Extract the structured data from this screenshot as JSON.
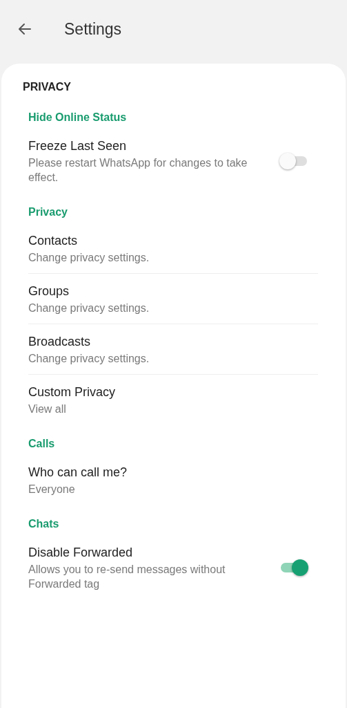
{
  "header": {
    "title": "Settings"
  },
  "section_title": "PRIVACY",
  "groups": [
    {
      "title": "Hide Online Status",
      "items": [
        {
          "kind": "toggle",
          "title": "Freeze Last Seen",
          "subtitle": "Please restart WhatsApp for changes to take effect.",
          "on": false
        }
      ]
    },
    {
      "title": "Privacy",
      "items": [
        {
          "kind": "link",
          "title": "Contacts",
          "subtitle": "Change privacy settings."
        },
        {
          "kind": "link",
          "title": "Groups",
          "subtitle": "Change privacy settings."
        },
        {
          "kind": "link",
          "title": "Broadcasts",
          "subtitle": "Change privacy settings."
        },
        {
          "kind": "link",
          "title": "Custom Privacy",
          "subtitle": "View all"
        }
      ]
    },
    {
      "title": "Calls",
      "items": [
        {
          "kind": "link",
          "title": "Who can call me?",
          "subtitle": "Everyone"
        }
      ]
    },
    {
      "title": "Chats",
      "items": [
        {
          "kind": "toggle",
          "title": "Disable Forwarded",
          "subtitle": "Allows you to re-send messages without Forwarded tag",
          "on": true
        }
      ]
    }
  ]
}
